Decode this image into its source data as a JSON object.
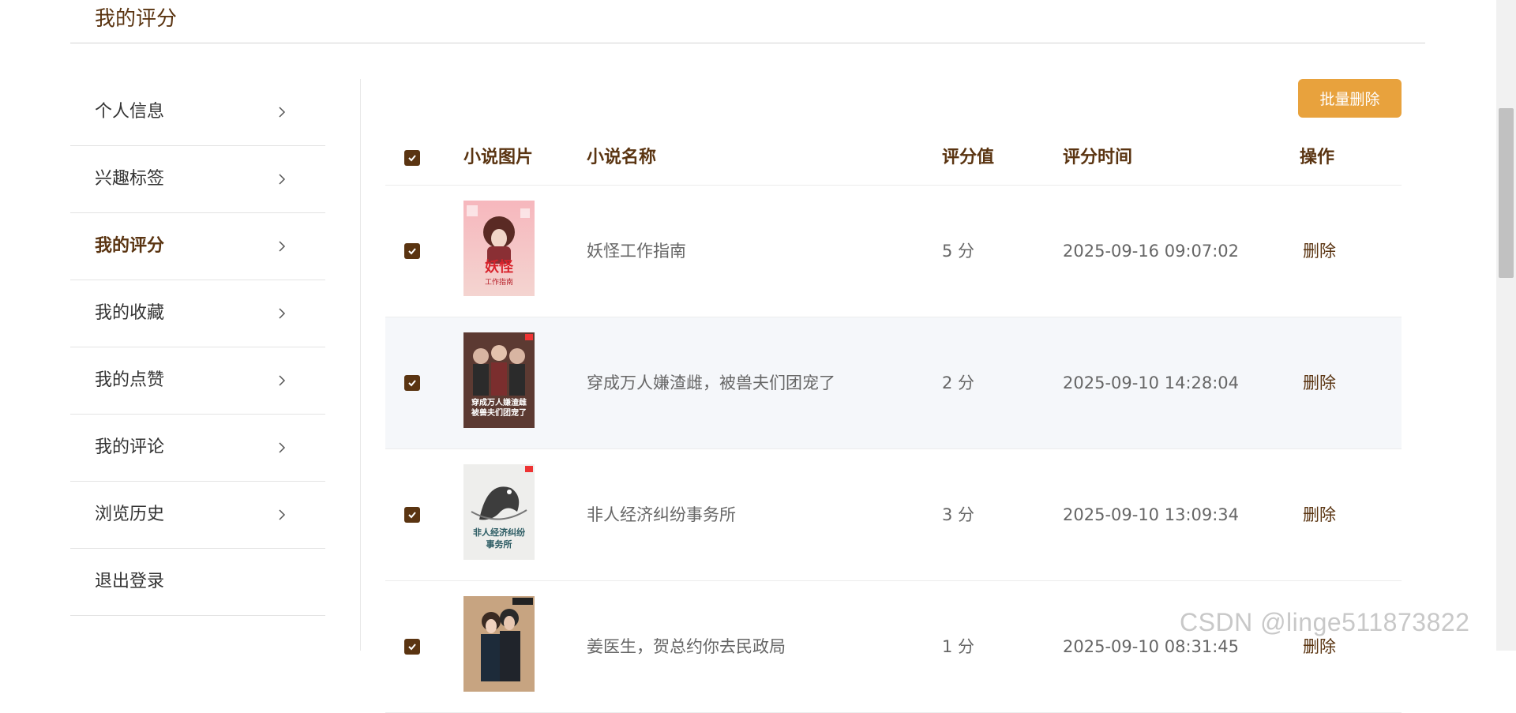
{
  "page": {
    "title": "我的评分"
  },
  "sidebar": {
    "items": [
      {
        "label": "个人信息",
        "active": false
      },
      {
        "label": "兴趣标签",
        "active": false
      },
      {
        "label": "我的评分",
        "active": true
      },
      {
        "label": "我的收藏",
        "active": false
      },
      {
        "label": "我的点赞",
        "active": false
      },
      {
        "label": "我的评论",
        "active": false
      },
      {
        "label": "浏览历史",
        "active": false
      },
      {
        "label": "退出登录",
        "active": false
      }
    ]
  },
  "toolbar": {
    "batch_delete_label": "批量删除"
  },
  "table": {
    "headers": {
      "image": "小说图片",
      "name": "小说名称",
      "score": "评分值",
      "time": "评分时间",
      "action": "操作"
    },
    "rows": [
      {
        "name": "妖怪工作指南",
        "score": "5 分",
        "time": "2025-09-16 09:07:02",
        "action": "删除",
        "checked": true,
        "cover_text": "妖怪",
        "cover_sub": "工作指南"
      },
      {
        "name": "穿成万人嫌渣雌，被兽夫们团宠了",
        "score": "2 分",
        "time": "2025-09-10 14:28:04",
        "action": "删除",
        "checked": true,
        "cover_text": "穿成万人嫌渣雌",
        "cover_sub": "被兽夫们团宠了"
      },
      {
        "name": "非人经济纠纷事务所",
        "score": "3 分",
        "time": "2025-09-10 13:09:34",
        "action": "删除",
        "checked": true,
        "cover_text": "非人经济纠纷",
        "cover_sub": "事务所"
      },
      {
        "name": "姜医生，贺总约你去民政局",
        "score": "1 分",
        "time": "2025-09-10 08:31:45",
        "action": "删除",
        "checked": true,
        "cover_text": "",
        "cover_sub": ""
      }
    ]
  },
  "watermark": "CSDN @linge511873822",
  "colors": {
    "accent": "#5a3411",
    "button": "#e8a23d",
    "row_highlight": "#f5f7fa"
  }
}
